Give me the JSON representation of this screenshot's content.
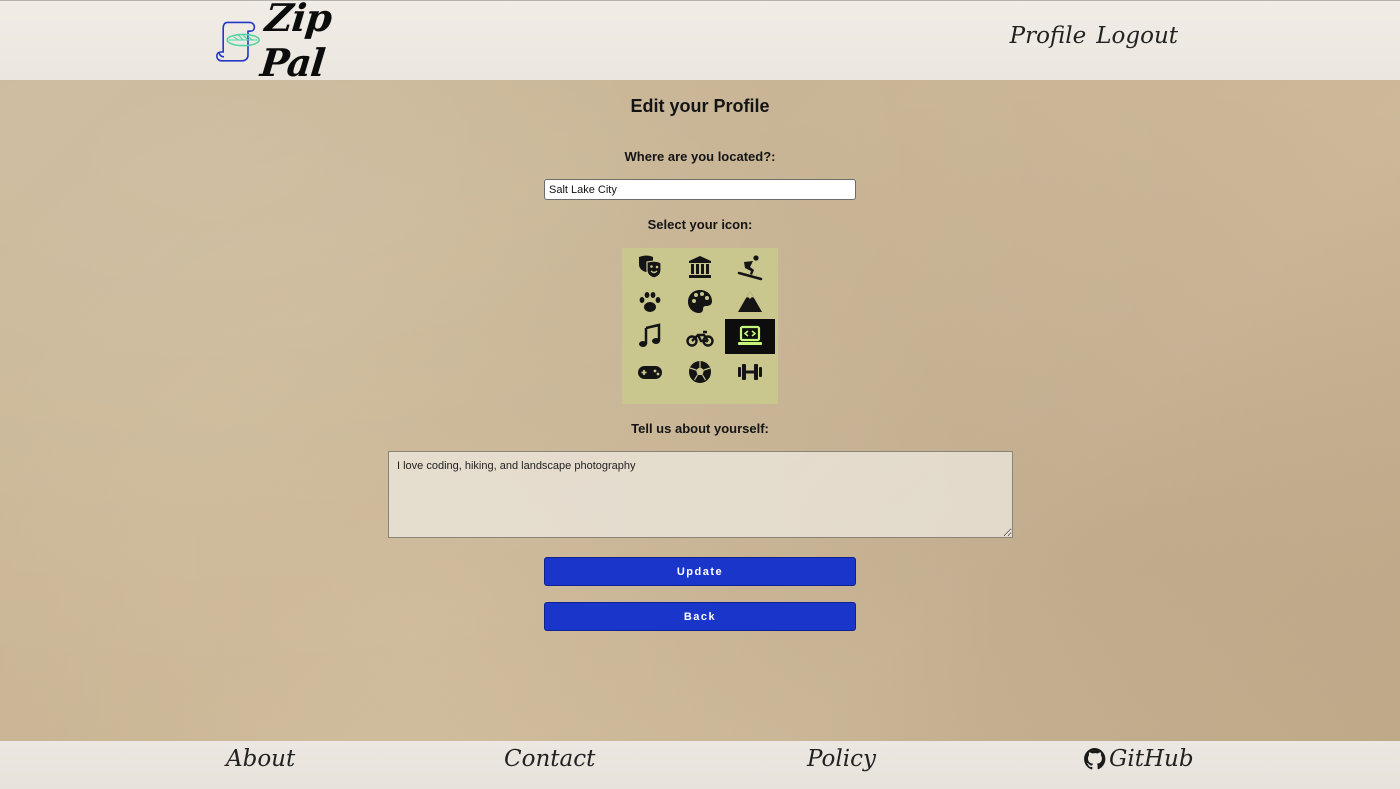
{
  "header": {
    "logo_text": "Zip Pal",
    "nav": {
      "profile": "Profile",
      "logout": "Logout"
    }
  },
  "form": {
    "title": "Edit your Profile",
    "location_label": "Where are you located?:",
    "location_value": "Salt Lake City",
    "icon_label": "Select your icon:",
    "icons": [
      "theater-masks-icon",
      "landmark-icon",
      "snowboarding-icon",
      "paw-icon",
      "palette-icon",
      "mountain-icon",
      "music-icon",
      "motorcycle-icon",
      "laptop-code-icon",
      "gamepad-icon",
      "soccer-ball-icon",
      "dumbbell-icon",
      "partial-icon-1",
      "partial-icon-2",
      "partial-icon-3"
    ],
    "selected_icon": "laptop-code-icon",
    "selected_icon_color": "#c6f77a",
    "bio_label": "Tell us about yourself:",
    "bio_value": "I love coding, hiking, and landscape photography",
    "update_label": "Update",
    "back_label": "Back"
  },
  "footer": {
    "about": "About",
    "contact": "Contact",
    "policy": "Policy",
    "github": "GitHub"
  },
  "colors": {
    "button": "#1a35c9",
    "icon_grid_bg": "#c9c68e",
    "header_bg": "#eeeae3"
  }
}
